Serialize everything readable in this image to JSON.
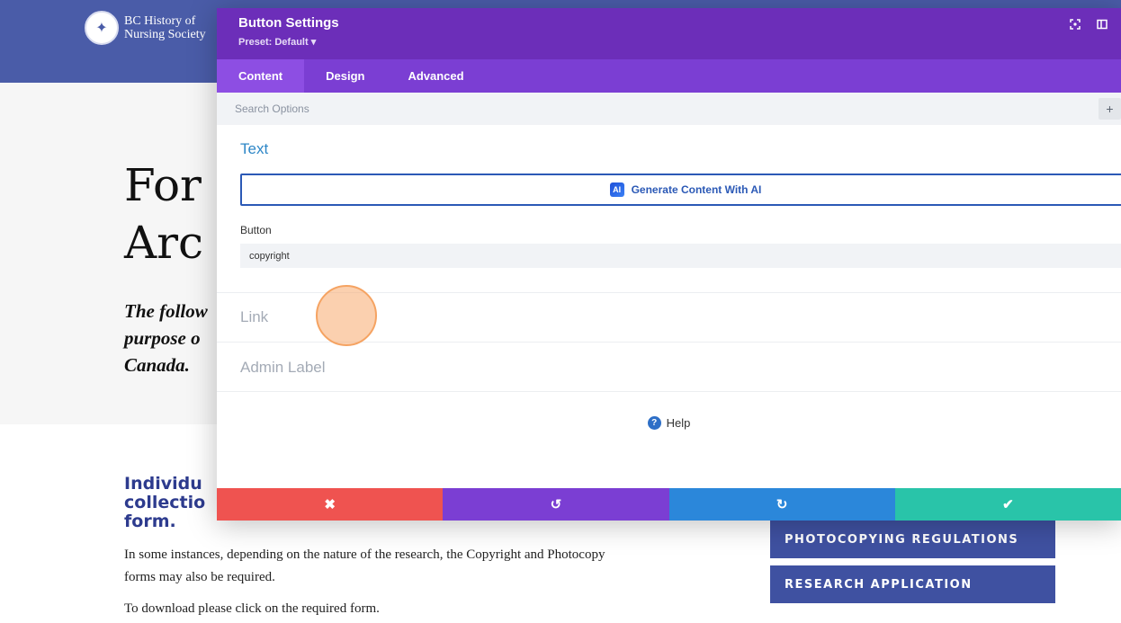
{
  "site": {
    "logo_line1": "BC History of",
    "logo_line2": "Nursing Society",
    "hero_title_line1": "For",
    "hero_title_line2": "Arc",
    "hero_sub_line1": "The follow",
    "hero_sub_line2": "purpose o",
    "hero_sub_line3": "Canada.",
    "section_title_line1": "Individu",
    "section_title_line2": "collectio",
    "section_title_line3": "form.",
    "body_line1": "In some instances, depending on the nature of the research, the Copyright and Photocopy",
    "body_line2": "forms may also be required.",
    "body_line3": "To download please click on the required form.",
    "button_photocopy": "PHOTOCOPYING REGULATIONS",
    "button_research": "RESEARCH APPLICATION"
  },
  "modal": {
    "title": "Button Settings",
    "preset": "Preset: Default ▾",
    "tabs": [
      {
        "label": "Content",
        "active": true
      },
      {
        "label": "Design",
        "active": false
      },
      {
        "label": "Advanced",
        "active": false
      }
    ],
    "search_placeholder": "Search Options",
    "plus": "+",
    "group_text": "Text",
    "ai_button": "Generate Content With AI",
    "ai_badge": "AI",
    "field_button_label": "Button",
    "field_button_value": "copyright",
    "group_link": "Link",
    "group_admin_label": "Admin Label",
    "help_label": "Help",
    "help_icon": "?",
    "footer": {
      "close": "✖",
      "undo": "↺",
      "redo": "↻",
      "save": "✔"
    }
  },
  "colors": {
    "header": "#6c2eb9",
    "tabs": "#7b3ed3",
    "close": "#ef5350",
    "undo": "#7b3ed3",
    "redo": "#2b87da",
    "save": "#29c4a9",
    "site_header": "#4a5ca8"
  },
  "icons": {
    "logo": "nursing-lamp-seal",
    "header_left": "focus-icon",
    "header_right": "sidebar-layout-icon"
  }
}
